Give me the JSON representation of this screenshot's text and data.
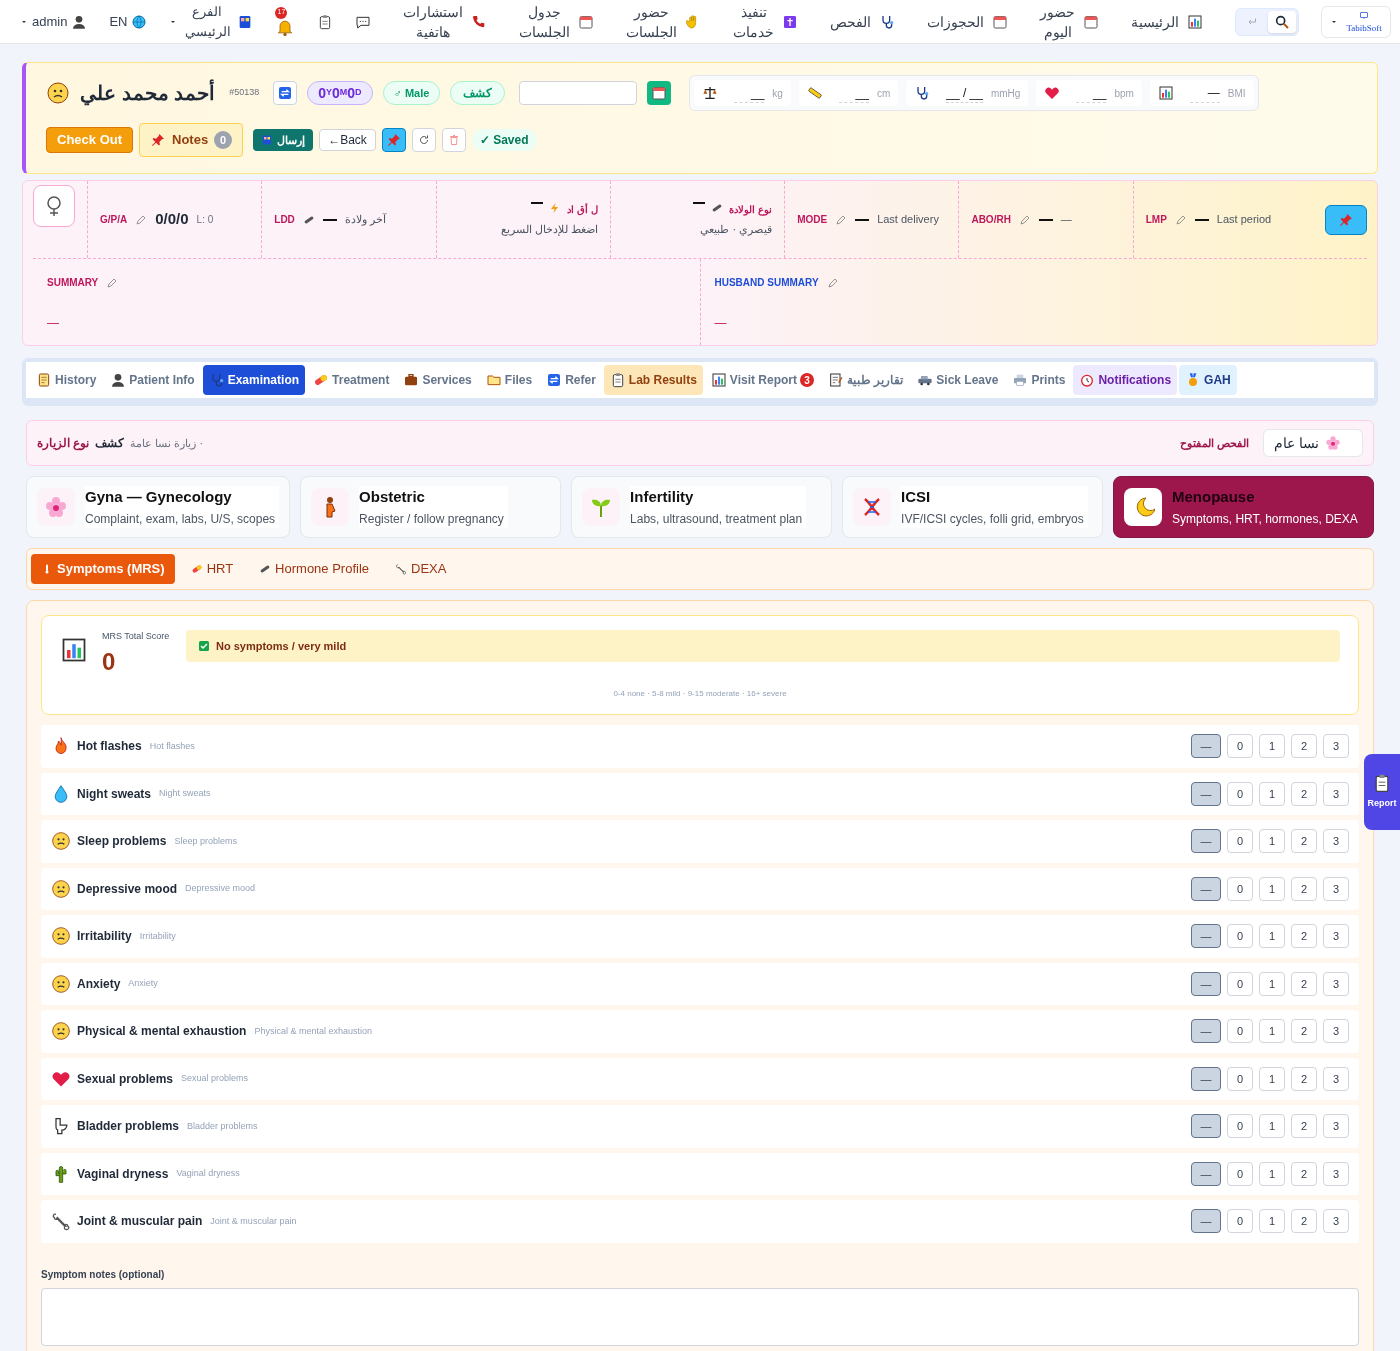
{
  "topbar": {
    "logo": "TabibSoft",
    "user": "admin",
    "lang": "EN",
    "branch": "الفرع الرئيسي",
    "notification_count": "17",
    "search_toggle": [
      {
        "kind": "back",
        "selected": false
      },
      {
        "kind": "search",
        "selected": true
      }
    ],
    "nav": [
      {
        "label": "الرئيسية"
      },
      {
        "label": "حضور اليوم"
      },
      {
        "label": "الحجوزات"
      },
      {
        "label": "الفحص"
      },
      {
        "label": "تنفيذ خدمات"
      },
      {
        "label": "حضور الجلسات"
      },
      {
        "label": "جدول الجلسات"
      },
      {
        "label": "استشارات هاتفية"
      }
    ]
  },
  "patient": {
    "name": "أحمد محمد علي",
    "id": "#50138",
    "age": [
      {
        "n": "0",
        "u": "Y"
      },
      {
        "n": "0",
        "u": "M"
      },
      {
        "n": "0",
        "u": "D"
      }
    ],
    "gender": "♂ Male",
    "visit_type": "كشف",
    "vitals": [
      {
        "value": "__",
        "unit": "kg"
      },
      {
        "value": "__",
        "unit": "cm"
      },
      {
        "value": "__ / __",
        "unit": "mmHg"
      },
      {
        "value": "__",
        "unit": "bpm"
      },
      {
        "value": "—",
        "unit": "BMI"
      }
    ],
    "actions": {
      "checkout": "Check Out",
      "notes": "Notes",
      "notes_count": "0",
      "send": "إرسال",
      "back": "←Back",
      "saved": "✓ Saved"
    }
  },
  "ob": {
    "fields": [
      {
        "label": "G/P/A",
        "value": "0/0/0",
        "extra": "L: 0"
      },
      {
        "label": "LDD",
        "value": "آخر ولادة"
      },
      {
        "label": "ل أق اد",
        "value": "اضغط للإدخال السريع"
      },
      {
        "label": "نوع الولادة",
        "value": "قيصري · طبيعي"
      },
      {
        "label": "MODE",
        "value": "Last delivery"
      },
      {
        "label": "ABO/RH",
        "value": "—"
      },
      {
        "label": "LMP",
        "value": "Last period"
      }
    ],
    "summary": {
      "label": "SUMMARY",
      "value": "—"
    },
    "husband_summary": {
      "label": "HUSBAND SUMMARY",
      "value": "—"
    }
  },
  "tabs": [
    {
      "label": "History",
      "selected": false
    },
    {
      "label": "Patient Info",
      "selected": false
    },
    {
      "label": "Examination",
      "selected": true
    },
    {
      "label": "Treatment",
      "selected": false
    },
    {
      "label": "Services",
      "selected": false
    },
    {
      "label": "Files",
      "selected": false
    },
    {
      "label": "Refer",
      "selected": false
    },
    {
      "label": "Lab Results",
      "selected": false
    },
    {
      "label": "Visit Report",
      "selected": false,
      "badge": "3"
    },
    {
      "label": "تقارير طبية",
      "selected": false
    },
    {
      "label": "Sick Leave",
      "selected": false
    },
    {
      "label": "Prints",
      "selected": false
    },
    {
      "label": "Notifications",
      "selected": false
    },
    {
      "label": "GAH",
      "selected": false
    }
  ],
  "visit": {
    "label": "نوع الزيارة",
    "type": "كشف",
    "subtype": "زيارة نسا عامة ·",
    "open_label": "الفحص المفتوح",
    "open_value": "نسا عام"
  },
  "specialties": [
    {
      "title": "Gyna — Gynecology",
      "subtitle": "Complaint, exam, labs, U/S, scopes",
      "selected": false
    },
    {
      "title": "Obstetric",
      "subtitle": "Register / follow pregnancy",
      "selected": false
    },
    {
      "title": "Infertility",
      "subtitle": "Labs, ultrasound, treatment plan",
      "selected": false
    },
    {
      "title": "ICSI",
      "subtitle": "IVF/ICSI cycles, folli grid, embryos",
      "selected": false
    },
    {
      "title": "Menopause",
      "subtitle": "Symptoms, HRT, hormones, DEXA",
      "selected": true
    }
  ],
  "subtabs": [
    {
      "label": "Symptoms (MRS)",
      "selected": true
    },
    {
      "label": "HRT",
      "selected": false
    },
    {
      "label": "Hormone Profile",
      "selected": false
    },
    {
      "label": "DEXA",
      "selected": false
    }
  ],
  "score": {
    "label": "MRS Total Score",
    "value": "0",
    "verdict": "No symptoms / very mild",
    "legend": "0-4 none · 5-8 mild · 9-15 moderate · 16+ severe"
  },
  "symptoms": [
    {
      "name": "Hot flashes",
      "hint": "Hot flashes",
      "scores": [
        {
          "label": "—",
          "selected": true
        },
        {
          "label": "0",
          "selected": false
        },
        {
          "label": "1",
          "selected": false
        },
        {
          "label": "2",
          "selected": false
        },
        {
          "label": "3",
          "selected": false
        }
      ]
    },
    {
      "name": "Night sweats",
      "hint": "Night sweats",
      "scores": [
        {
          "label": "—",
          "selected": true
        },
        {
          "label": "0",
          "selected": false
        },
        {
          "label": "1",
          "selected": false
        },
        {
          "label": "2",
          "selected": false
        },
        {
          "label": "3",
          "selected": false
        }
      ]
    },
    {
      "name": "Sleep problems",
      "hint": "Sleep problems",
      "scores": [
        {
          "label": "—",
          "selected": true
        },
        {
          "label": "0",
          "selected": false
        },
        {
          "label": "1",
          "selected": false
        },
        {
          "label": "2",
          "selected": false
        },
        {
          "label": "3",
          "selected": false
        }
      ]
    },
    {
      "name": "Depressive mood",
      "hint": "Depressive mood",
      "scores": [
        {
          "label": "—",
          "selected": true
        },
        {
          "label": "0",
          "selected": false
        },
        {
          "label": "1",
          "selected": false
        },
        {
          "label": "2",
          "selected": false
        },
        {
          "label": "3",
          "selected": false
        }
      ]
    },
    {
      "name": "Irritability",
      "hint": "Irritability",
      "scores": [
        {
          "label": "—",
          "selected": true
        },
        {
          "label": "0",
          "selected": false
        },
        {
          "label": "1",
          "selected": false
        },
        {
          "label": "2",
          "selected": false
        },
        {
          "label": "3",
          "selected": false
        }
      ]
    },
    {
      "name": "Anxiety",
      "hint": "Anxiety",
      "scores": [
        {
          "label": "—",
          "selected": true
        },
        {
          "label": "0",
          "selected": false
        },
        {
          "label": "1",
          "selected": false
        },
        {
          "label": "2",
          "selected": false
        },
        {
          "label": "3",
          "selected": false
        }
      ]
    },
    {
      "name": "Physical & mental exhaustion",
      "hint": "Physical & mental exhaustion",
      "scores": [
        {
          "label": "—",
          "selected": true
        },
        {
          "label": "0",
          "selected": false
        },
        {
          "label": "1",
          "selected": false
        },
        {
          "label": "2",
          "selected": false
        },
        {
          "label": "3",
          "selected": false
        }
      ]
    },
    {
      "name": "Sexual problems",
      "hint": "Sexual problems",
      "scores": [
        {
          "label": "—",
          "selected": true
        },
        {
          "label": "0",
          "selected": false
        },
        {
          "label": "1",
          "selected": false
        },
        {
          "label": "2",
          "selected": false
        },
        {
          "label": "3",
          "selected": false
        }
      ]
    },
    {
      "name": "Bladder problems",
      "hint": "Bladder problems",
      "scores": [
        {
          "label": "—",
          "selected": true
        },
        {
          "label": "0",
          "selected": false
        },
        {
          "label": "1",
          "selected": false
        },
        {
          "label": "2",
          "selected": false
        },
        {
          "label": "3",
          "selected": false
        }
      ]
    },
    {
      "name": "Vaginal dryness",
      "hint": "Vaginal dryness",
      "scores": [
        {
          "label": "—",
          "selected": true
        },
        {
          "label": "0",
          "selected": false
        },
        {
          "label": "1",
          "selected": false
        },
        {
          "label": "2",
          "selected": false
        },
        {
          "label": "3",
          "selected": false
        }
      ]
    },
    {
      "name": "Joint & muscular pain",
      "hint": "Joint & muscular pain",
      "scores": [
        {
          "label": "—",
          "selected": true
        },
        {
          "label": "0",
          "selected": false
        },
        {
          "label": "1",
          "selected": false
        },
        {
          "label": "2",
          "selected": false
        },
        {
          "label": "3",
          "selected": false
        }
      ]
    }
  ],
  "notes": {
    "label": "Symptom notes (optional)"
  },
  "report_button": "Report"
}
